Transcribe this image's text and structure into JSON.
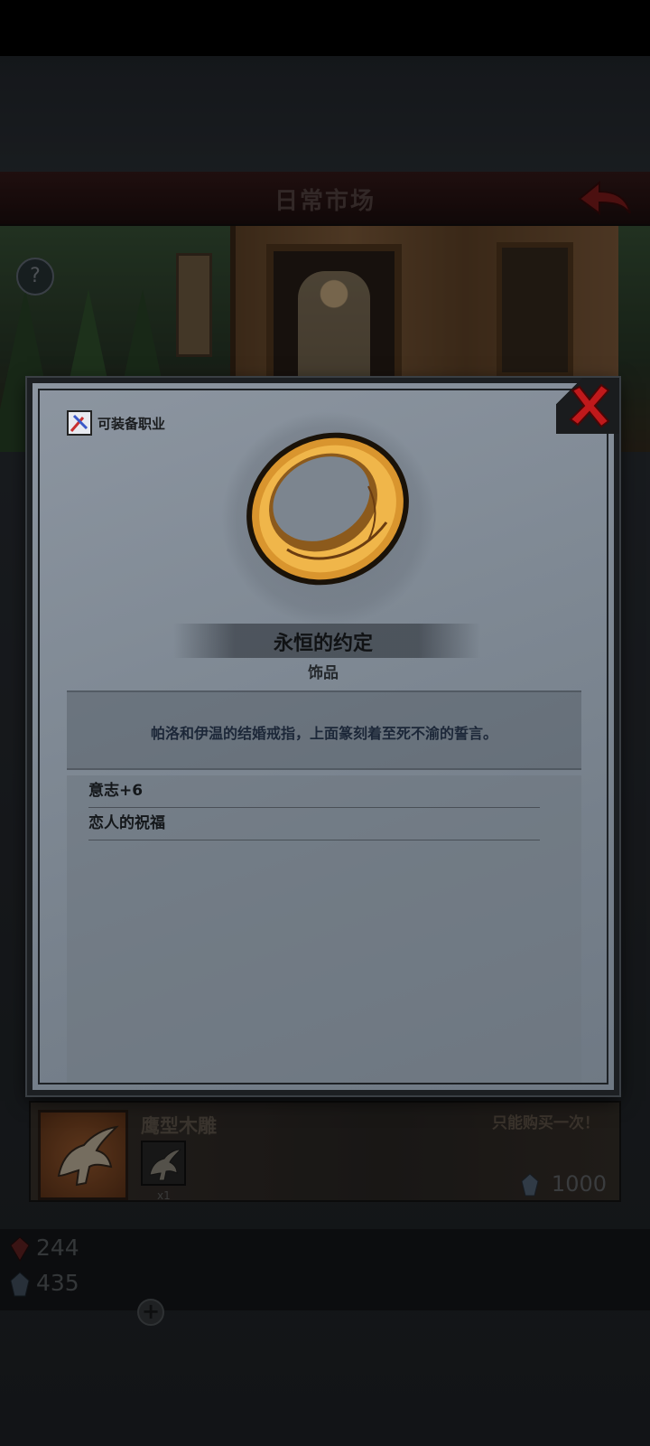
{
  "header": {
    "title": "日常市场"
  },
  "scene": {
    "help_label": "?"
  },
  "shop": {
    "item_name": "鹰型木雕",
    "limit_note": "只能购买一次！",
    "sub_count": "x1",
    "price": "1000"
  },
  "currencies": [
    {
      "icon": "red-crystal-icon",
      "value": "244"
    },
    {
      "icon": "blue-crystal-icon",
      "value": "435"
    }
  ],
  "modal": {
    "class_label": "可装备职业",
    "item_name": "永恒的约定",
    "item_type": "饰品",
    "description": "帕洛和伊温的结婚戒指，上面篆刻着至死不渝的誓言。",
    "stats": [
      "意志+6",
      "恋人的祝福"
    ]
  },
  "colors": {
    "close_red": "#c0191b",
    "ring_gold": "#d9952e",
    "desc_blue": "#1c2738"
  }
}
